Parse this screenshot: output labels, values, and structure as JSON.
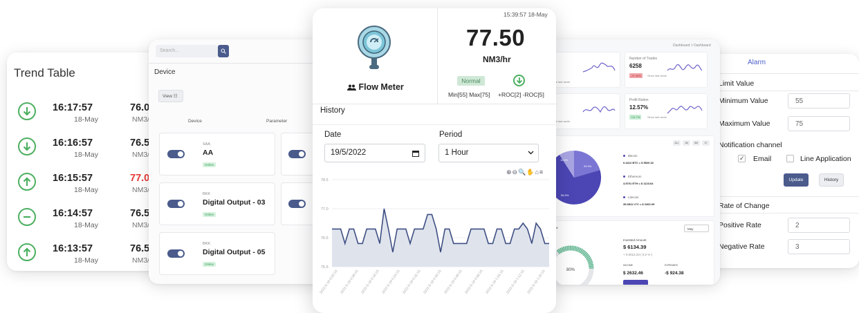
{
  "trend_table": {
    "title": "Trend Table",
    "rows": [
      {
        "icon": "arrow-down-circle-icon",
        "time": "16:17:57",
        "date": "18-May",
        "value": "76.0",
        "value_red": false,
        "unit": "NM3/"
      },
      {
        "icon": "arrow-down-circle-icon",
        "time": "16:16:57",
        "date": "18-May",
        "value": "76.5",
        "value_red": false,
        "unit": "NM3/"
      },
      {
        "icon": "arrow-up-circle-icon",
        "time": "16:15:57",
        "date": "18-May",
        "value": "77.0",
        "value_red": true,
        "unit": "NM3/"
      },
      {
        "icon": "minus-circle-icon",
        "time": "16:14:57",
        "date": "18-May",
        "value": "76.5",
        "value_red": false,
        "unit": "NM3/"
      },
      {
        "icon": "arrow-up-circle-icon",
        "time": "16:13:57",
        "date": "18-May",
        "value": "76.5",
        "value_red": false,
        "unit": "NM3/"
      }
    ]
  },
  "device_panel": {
    "search_placeholder": "Search...",
    "title": "Device",
    "view_button": "View ☷",
    "col_device": "Device",
    "col_parameter": "Parameter",
    "devices": [
      {
        "small": "SAA",
        "name": "AA",
        "status": "Online"
      },
      {
        "small": "BKK",
        "name": "Digital Output - 03",
        "status": "Online"
      },
      {
        "small": "BKK",
        "name": "Digital Output - 05",
        "status": "Online"
      }
    ]
  },
  "flow_meter": {
    "timestamp": "15:39:57 18-May",
    "value": "77.50",
    "unit": "NM3/hr",
    "label": "Flow Meter",
    "status": "Normal",
    "limits": "Min[55] Max[75]",
    "roc": "+ROC[2] -ROC[5]",
    "history_title": "History",
    "date_label": "Date",
    "date_value": "19/5/2022",
    "period_label": "Period",
    "period_value": "1 Hour",
    "toolbar_icons": "⊕⊖🔍✋⌂≡"
  },
  "chart_data": {
    "type": "area",
    "y_ticks": [
      "78.5",
      "77.0",
      "76.5",
      "75.5"
    ],
    "ylim": [
      75.5,
      78.5
    ],
    "x_ticks": [
      "2022-5-19 0:00:15",
      "2022-5-19 0:08:15",
      "2022-5-19 0:16:15",
      "2022-5-19 0:24:15",
      "2022-5-19 0:32:15",
      "2022-5-19 0:40:15",
      "2022-5-19 0:48:15",
      "2022-5-19 0:56:15",
      "2022-5-19 1:04:15",
      "2022-5-19 1:12:15",
      "2022-5-19 1:20:15"
    ],
    "values": [
      76.8,
      76.8,
      76.8,
      76.3,
      76.8,
      76.8,
      76.3,
      76.3,
      76.8,
      76.8,
      76.8,
      76.3,
      77.5,
      76.8,
      76.0,
      76.8,
      76.8,
      76.8,
      76.3,
      76.8,
      76.8,
      76.8,
      77.3,
      77.3,
      76.8,
      76.0,
      76.8,
      76.8,
      76.3,
      76.3,
      76.3,
      76.3,
      76.8,
      76.8,
      76.8,
      76.8,
      76.3,
      76.3,
      76.8,
      76.8,
      76.3,
      76.3,
      76.8,
      76.8,
      77.0,
      76.8,
      76.3,
      77.0,
      76.8,
      76.3,
      76.3
    ]
  },
  "dashboard": {
    "breadcrumb": "Dashboard  >  Dashboard",
    "stats": [
      {
        "label": "",
        "value": "",
        "badge": "",
        "since": "Since last week"
      },
      {
        "label": "Number of Trades",
        "value": "6258",
        "badge": "-27.40%",
        "since": "Since last week"
      },
      {
        "label": "",
        "value": "",
        "badge": "",
        "since": "Since last week"
      },
      {
        "label": "Profit Ration",
        "value": "12.57%",
        "badge": "+11.7%",
        "since": "Since last week"
      }
    ],
    "pie_labels": [
      "11.9%",
      "39.3%",
      "56.9%"
    ],
    "tabs": [
      "ALL",
      "1M",
      "6M",
      "1Y"
    ],
    "coins": [
      {
        "name": "Bitcoin",
        "amount": "0.4412 BTC = $ 9520.32"
      },
      {
        "name": "Ethereum",
        "amount": "4.5701 ETH = $ 1123.64"
      },
      {
        "name": "Litecoin",
        "amount": "35.3811 LTC = $ 2263.09"
      }
    ],
    "overview_title": "rview",
    "invested_label": "Invested Amount",
    "invested_value": "$ 6134.39",
    "invested_change": "+ 0.0012.23 ( 0.2 % )",
    "income_label": "INCOME",
    "income_value": "$ 2632.46",
    "expenses_label": "EXPENSES",
    "expenses_value": "-$ 924.38",
    "donut_value": "80%",
    "period_select": "May"
  },
  "alarm": {
    "title": "Alarm",
    "limit_value": "Limit Value",
    "minimum_label": "Minimum Value",
    "minimum_value": "55",
    "maximum_label": "Maximum Value",
    "maximum_value": "75",
    "notification": "Notification channel",
    "email_label": "Email",
    "line_label": "Line Application",
    "update_button": "Update",
    "history_button": "History",
    "rate_of_change": "Rate of Change",
    "positive_label": "Positive Rate",
    "positive_value": "2",
    "negative_label": "Negative Rate",
    "negative_value": "3"
  },
  "colors": {
    "accent": "#4a5b8c",
    "success": "#4caf60",
    "alert": "#e53935",
    "chart_line": "#3e4f83",
    "chart_fill": "#dfe3ec"
  }
}
